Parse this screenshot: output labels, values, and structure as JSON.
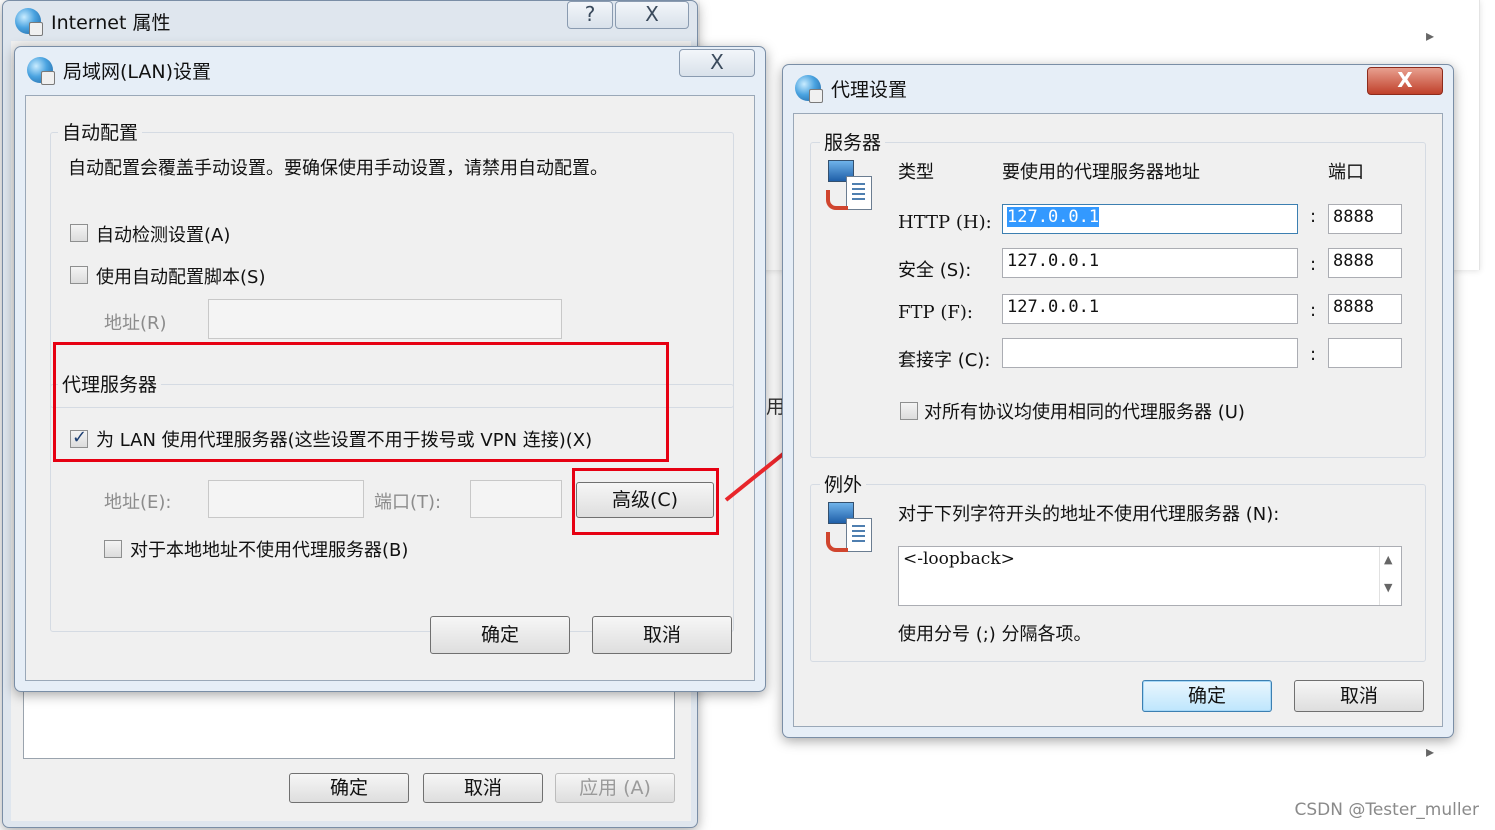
{
  "colors": {
    "highlight_red": "#e60012",
    "arrow_red": "#e8262b",
    "title_bg": "#e6eef7",
    "client_bg": "#f0f0f0"
  },
  "internet_props": {
    "title": "Internet 属性",
    "help_glyph": "?",
    "close_glyph": "X",
    "ok_label": "确定",
    "cancel_label": "取消",
    "apply_label": "应用 (A)",
    "partial_text": "用"
  },
  "lan_dialog": {
    "title": "局域网(LAN)设置",
    "close_glyph": "X",
    "auto_config": {
      "group_label": "自动配置",
      "description": "自动配置会覆盖手动设置。要确保使用手动设置，请禁用自动配置。",
      "auto_detect_label": "自动检测设置(A)",
      "auto_detect_checked": false,
      "use_script_label": "使用自动配置脚本(S)",
      "use_script_checked": false,
      "address_label": "地址(R)",
      "address_value": ""
    },
    "proxy_server": {
      "group_label": "代理服务器",
      "use_proxy_label": "为 LAN 使用代理服务器(这些设置不用于拨号或 VPN 连接)(X)",
      "use_proxy_checked": true,
      "address_label": "地址(E):",
      "address_value": "",
      "port_label": "端口(T):",
      "port_value": "",
      "advanced_label": "高级(C)",
      "bypass_local_label": "对于本地地址不使用代理服务器(B)",
      "bypass_local_checked": false
    },
    "ok_label": "确定",
    "cancel_label": "取消"
  },
  "proxy_dialog": {
    "title": "代理设置",
    "close_glyph": "X",
    "servers": {
      "group_label": "服务器",
      "col_type": "类型",
      "col_address": "要使用的代理服务器地址",
      "col_port": "端口",
      "rows": [
        {
          "label": "HTTP (H):",
          "address": "127.0.0.1",
          "port": "8888"
        },
        {
          "label": "安全 (S):",
          "address": "127.0.0.1",
          "port": "8888"
        },
        {
          "label": "FTP (F):",
          "address": "127.0.0.1",
          "port": "8888"
        },
        {
          "label": "套接字 (C):",
          "address": "",
          "port": ""
        }
      ],
      "colon": ":",
      "same_proxy_label": "对所有协议均使用相同的代理服务器 (U)",
      "same_proxy_checked": false
    },
    "exceptions": {
      "group_label": "例外",
      "description": "对于下列字符开头的地址不使用代理服务器 (N):",
      "value": "<-loopback>",
      "hint": "使用分号 (;) 分隔各项。"
    },
    "ok_label": "确定",
    "cancel_label": "取消"
  },
  "watermark": "CSDN @Tester_muller"
}
